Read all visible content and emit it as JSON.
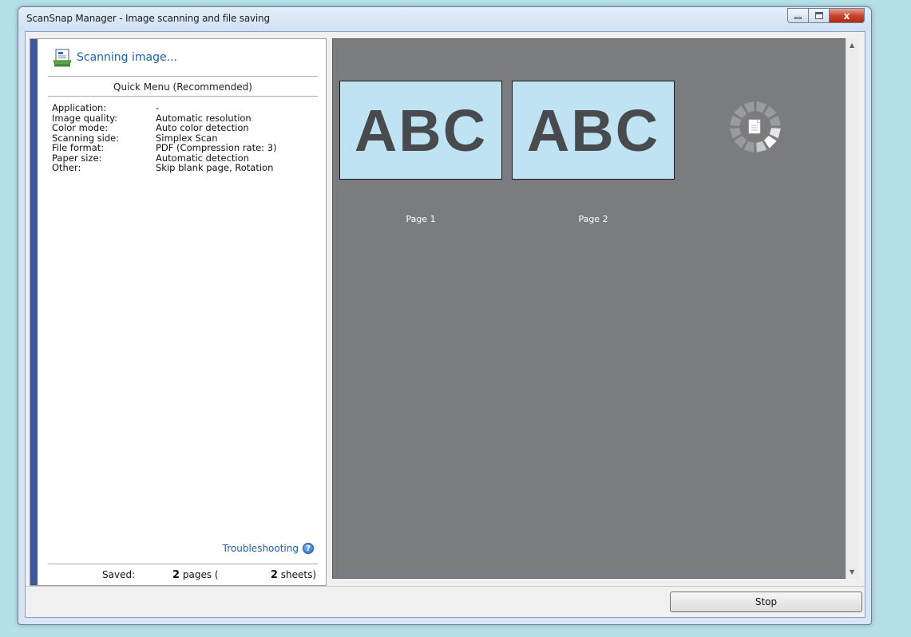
{
  "window": {
    "title": "ScanSnap Manager - Image scanning and file saving",
    "close_glyph": "x"
  },
  "left_panel": {
    "status": "Scanning image...",
    "menu_name": "Quick Menu (Recommended)",
    "settings": [
      {
        "label": "Application:",
        "value": "-"
      },
      {
        "label": "Image quality:",
        "value": "Automatic resolution"
      },
      {
        "label": "Color mode:",
        "value": "Auto color detection"
      },
      {
        "label": "Scanning side:",
        "value": "Simplex Scan"
      },
      {
        "label": "File format:",
        "value": "PDF (Compression rate: 3)"
      },
      {
        "label": "Paper size:",
        "value": "Automatic detection"
      },
      {
        "label": "Other:",
        "value": "Skip blank page, Rotation"
      }
    ],
    "troubleshooting": "Troubleshooting",
    "help_glyph": "?",
    "saved": {
      "label": "Saved:",
      "pages_count": "2",
      "pages_unit": "pages (",
      "sheets_count": "2",
      "sheets_unit": "sheets)"
    }
  },
  "preview": {
    "pages": [
      {
        "image_text": "ABC",
        "label": "Page 1"
      },
      {
        "image_text": "ABC",
        "label": "Page 2"
      }
    ],
    "scroll_up": "▲",
    "scroll_down": "▼"
  },
  "buttons": {
    "stop": "Stop"
  },
  "colors": {
    "accent": "#3c5a9a",
    "link": "#1f5fa8",
    "preview_bg": "#7b7c80",
    "thumb_bg": "#bfe3f2"
  },
  "icons": [
    "scan-document-icon",
    "help-icon",
    "loading-spinner-icon",
    "minimize-icon",
    "maximize-icon",
    "close-icon"
  ]
}
